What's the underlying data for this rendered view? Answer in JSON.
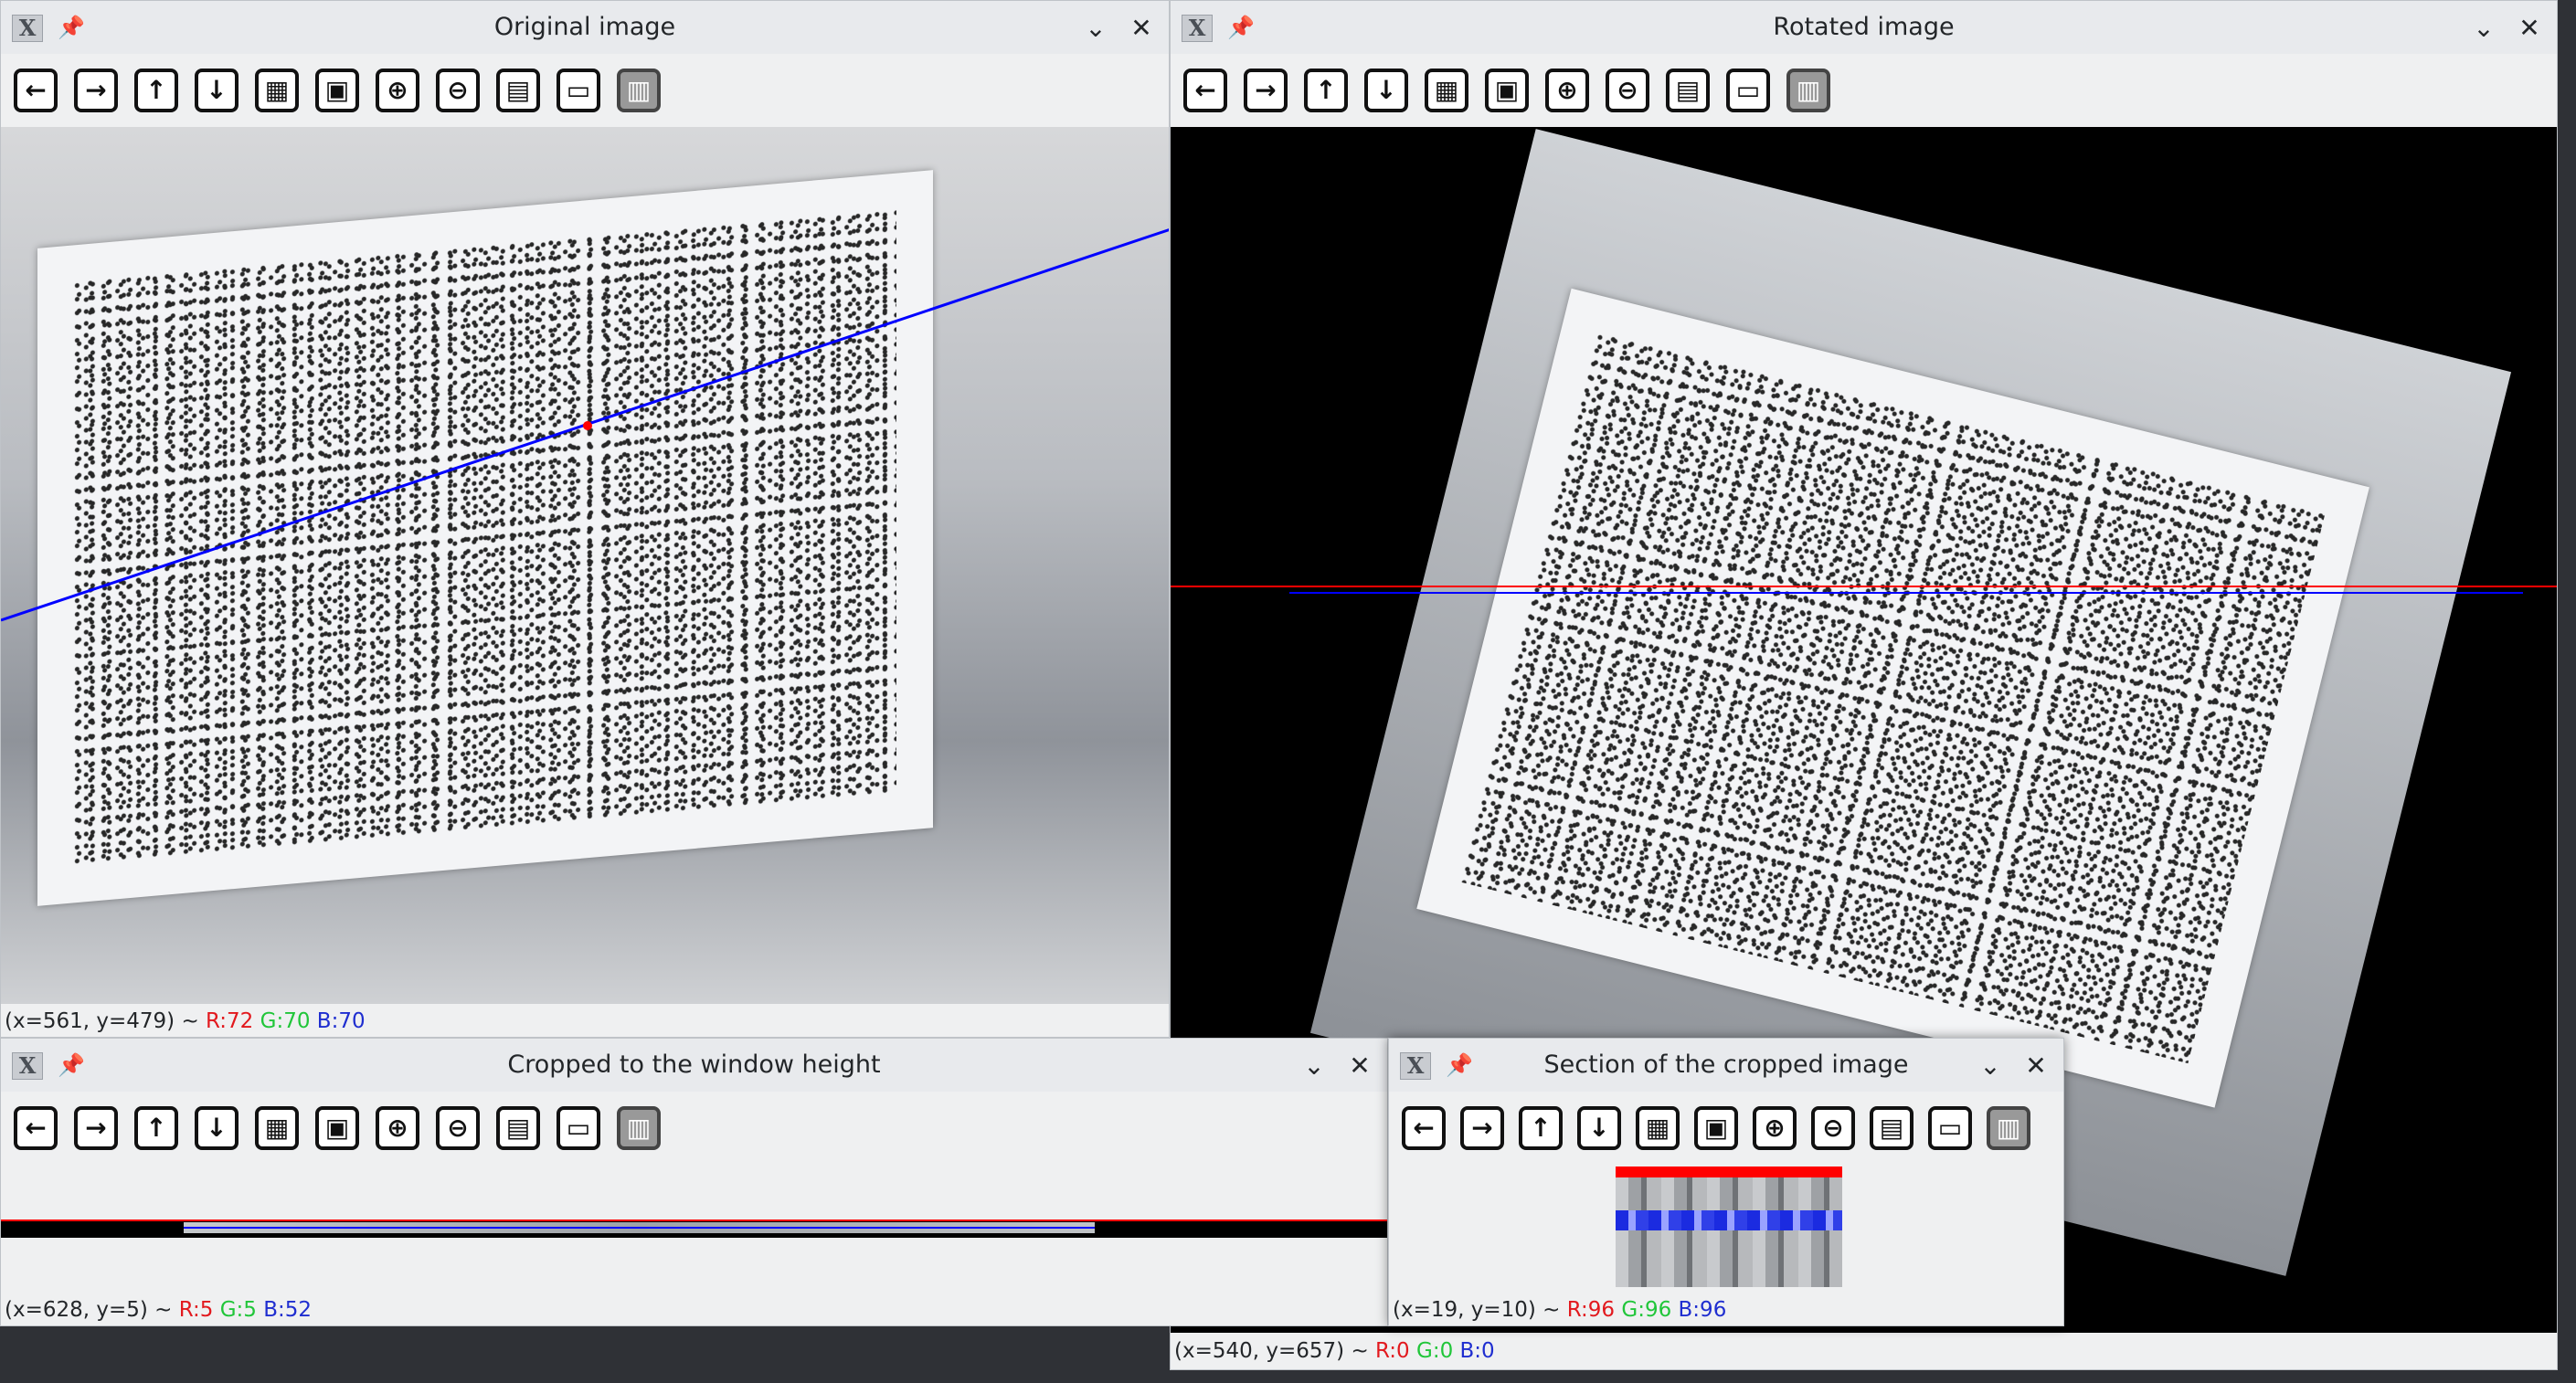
{
  "windows": {
    "original": {
      "title": "Original image",
      "status": {
        "coords": "(x=561, y=479) ~",
        "r": "R:72",
        "g": "G:70",
        "b": "B:70"
      }
    },
    "rotated": {
      "title": "Rotated image",
      "status": {
        "coords": "(x=540, y=657) ~",
        "r": "R:0",
        "g": "G:0",
        "b": "B:0"
      }
    },
    "cropped": {
      "title": "Cropped to the window height",
      "status": {
        "coords": "(x=628, y=5) ~",
        "r": "R:5",
        "g": "G:5",
        "b": "B:52"
      }
    },
    "section": {
      "title": "Section of the cropped image",
      "status": {
        "coords": "(x=19, y=10) ~",
        "r": "R:96",
        "g": "G:96",
        "b": "B:96"
      }
    }
  },
  "toolbar_icons": [
    "arrow-left-icon",
    "arrow-right-icon",
    "arrow-up-icon",
    "arrow-down-icon",
    "image-icon",
    "image-person-icon",
    "zoom-in-icon",
    "zoom-out-icon",
    "save-icon",
    "clipboard-icon",
    "properties-icon"
  ],
  "colors": {
    "line_red": "#ff0000",
    "line_blue": "#0000ff",
    "window_bg": "#eff0f1"
  }
}
